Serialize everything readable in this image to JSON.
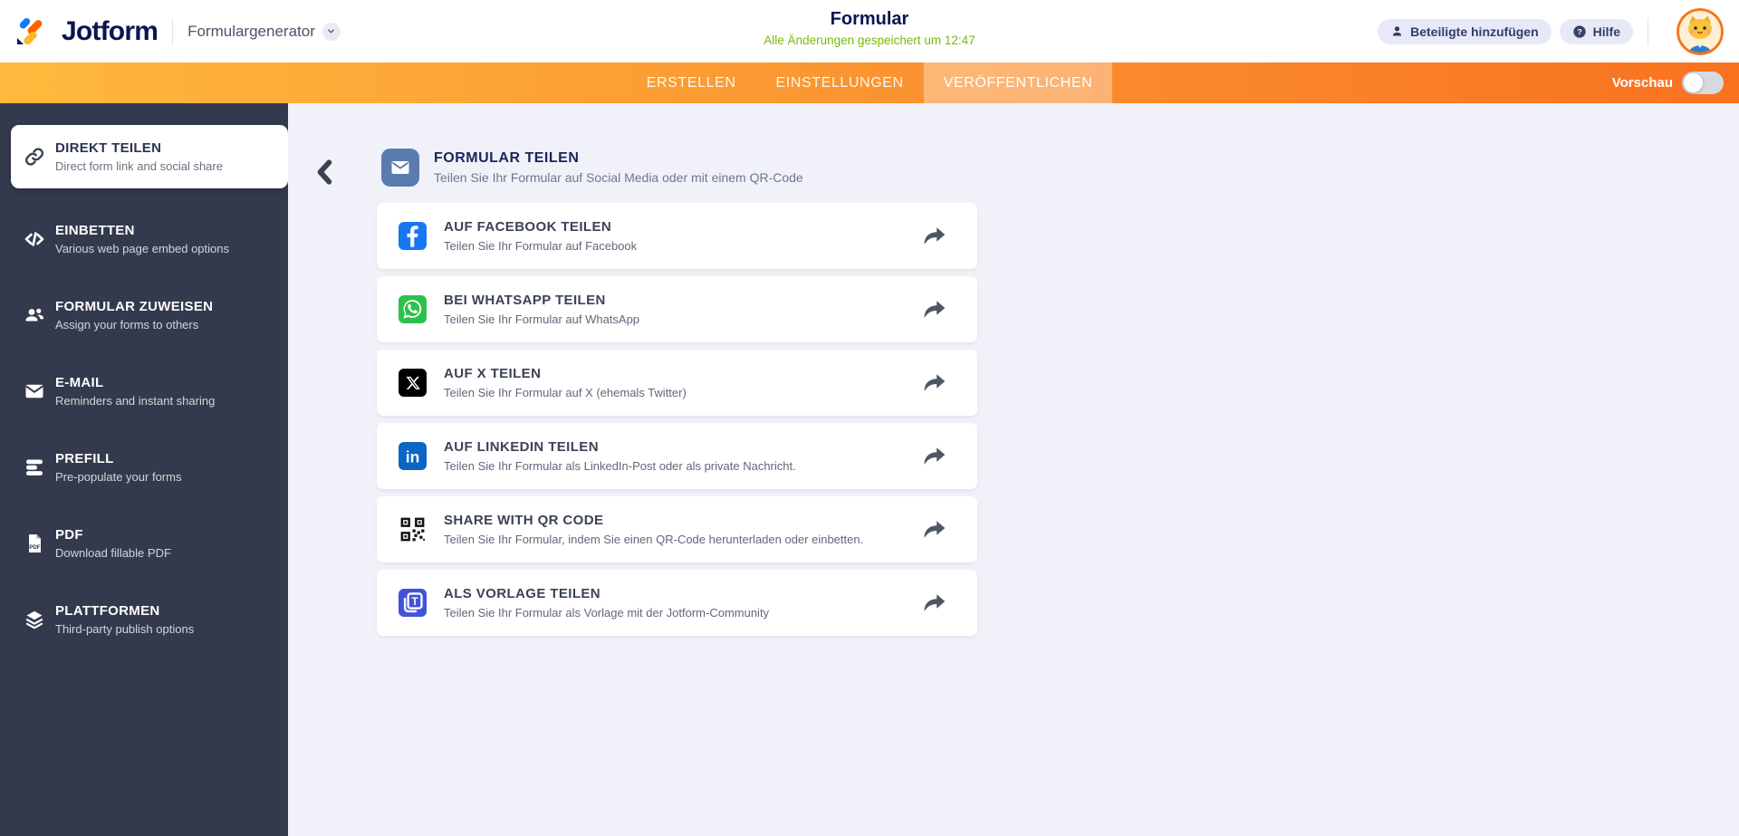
{
  "header": {
    "logo_text": "Jotform",
    "app_switcher_label": "Formulargenerator",
    "form_title": "Formular",
    "saved_status": "Alle Änderungen gespeichert um 12:47",
    "add_collaborators_label": "Beteiligte hinzufügen",
    "help_label": "Hilfe"
  },
  "navbar": {
    "tabs": [
      {
        "id": "erstellen",
        "label": "ERSTELLEN",
        "active": false
      },
      {
        "id": "einstellungen",
        "label": "EINSTELLUNGEN",
        "active": false
      },
      {
        "id": "veroeffentlichen",
        "label": "VERÖFFENTLICHEN",
        "active": true
      }
    ],
    "preview_label": "Vorschau",
    "preview_toggle_on": false
  },
  "sidebar": {
    "items": [
      {
        "id": "direkt-teilen",
        "title": "DIREKT TEILEN",
        "subtitle": "Direct form link and social share",
        "icon": "link-icon",
        "active": true
      },
      {
        "id": "einbetten",
        "title": "EINBETTEN",
        "subtitle": "Various web page embed options",
        "icon": "code-icon",
        "active": false
      },
      {
        "id": "formular-zuweisen",
        "title": "FORMULAR ZUWEISEN",
        "subtitle": "Assign your forms to others",
        "icon": "people-icon",
        "active": false
      },
      {
        "id": "e-mail",
        "title": "E-MAIL",
        "subtitle": "Reminders and instant sharing",
        "icon": "envelope-icon",
        "active": false
      },
      {
        "id": "prefill",
        "title": "PREFILL",
        "subtitle": "Pre-populate your forms",
        "icon": "rows-icon",
        "active": false
      },
      {
        "id": "pdf",
        "title": "PDF",
        "subtitle": "Download fillable PDF",
        "icon": "pdf-icon",
        "active": false
      },
      {
        "id": "plattformen",
        "title": "PLATTFORMEN",
        "subtitle": "Third-party publish options",
        "icon": "layers-icon",
        "active": false
      }
    ]
  },
  "main": {
    "section_title": "FORMULAR TEILEN",
    "section_subtitle": "Teilen Sie Ihr Formular auf Social Media oder mit einem QR-Code",
    "share_options": [
      {
        "id": "facebook",
        "title": "AUF FACEBOOK TEILEN",
        "subtitle": "Teilen Sie Ihr Formular auf Facebook",
        "icon": "facebook-icon",
        "tile_color": "#1877F2"
      },
      {
        "id": "whatsapp",
        "title": "BEI WHATSAPP TEILEN",
        "subtitle": "Teilen Sie Ihr Formular auf WhatsApp",
        "icon": "whatsapp-icon",
        "tile_color": "#2BC24A"
      },
      {
        "id": "x",
        "title": "AUF X TEILEN",
        "subtitle": "Teilen Sie Ihr Formular auf X (ehemals Twitter)",
        "icon": "x-icon",
        "tile_color": "#000000"
      },
      {
        "id": "linkedin",
        "title": "AUF LINKEDIN TEILEN",
        "subtitle": "Teilen Sie Ihr Formular als LinkedIn-Post oder als private Nachricht.",
        "icon": "linkedin-icon",
        "tile_color": "#0A66C2"
      },
      {
        "id": "qr-code",
        "title": "SHARE WITH QR CODE",
        "subtitle": "Teilen Sie Ihr Formular, indem Sie einen QR-Code herunterladen oder einbetten.",
        "icon": "qr-icon",
        "tile_color": "#FFFFFF"
      },
      {
        "id": "template",
        "title": "ALS VORLAGE TEILEN",
        "subtitle": "Teilen Sie Ihr Formular als Vorlage mit der Jotform-Community",
        "icon": "template-icon",
        "tile_color": "#4353D9"
      }
    ]
  },
  "colors": {
    "accent_navy": "#0A1551",
    "saved_green": "#78BB07",
    "navbar_gradient_left": "#FFB93D",
    "navbar_gradient_right": "#F9721F",
    "sidebar_bg": "#343A4D",
    "content_bg": "#F1F2F9"
  }
}
